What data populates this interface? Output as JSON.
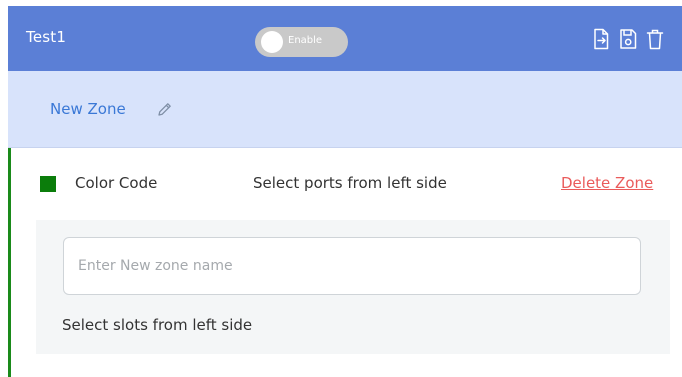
{
  "header": {
    "title": "Test1",
    "toggle_label": "Enable",
    "icons": [
      "export-icon",
      "save-icon",
      "trash-icon"
    ],
    "bg_color": "#5b7fd6"
  },
  "zone_bar": {
    "zone_name": "New Zone"
  },
  "zone_panel": {
    "color_code_label": "Color Code",
    "swatch_color": "#0b7d0b",
    "ports_hint": "Select ports from left side",
    "delete_label": "Delete Zone",
    "name_input": {
      "value": "",
      "placeholder": "Enter New zone name"
    },
    "slots_hint": "Select slots from left side"
  }
}
